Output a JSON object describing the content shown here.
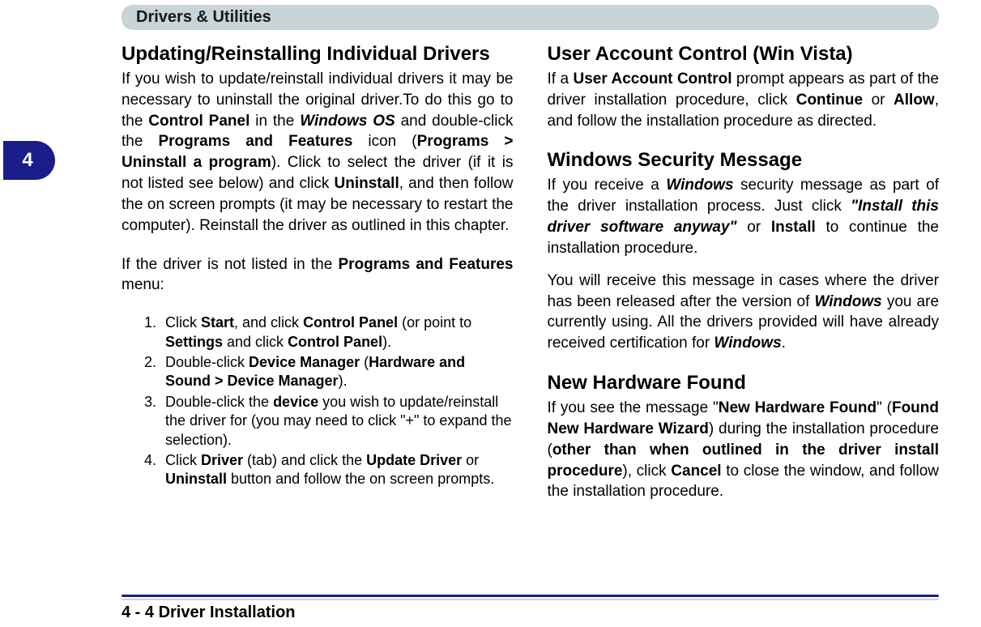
{
  "header": {
    "title": "Drivers & Utilities"
  },
  "chapter": {
    "tab": "4"
  },
  "left": {
    "h1": "Updating/Reinstalling Individual Drivers",
    "p1_a": "If you wish to update/reinstall individual drivers it may be necessary to uninstall the original driver.To do this go to the ",
    "p1_b": "Control Panel",
    "p1_c": " in the ",
    "p1_d": "Windows OS",
    "p1_e": " and double-click the ",
    "p1_f": "Programs and Features",
    "p1_g": " icon (",
    "p1_h": "Programs > Uninstall a program",
    "p1_i": "). Click to select the driver (if it is not listed see below) and click ",
    "p1_j": "Uninstall",
    "p1_k": ", and then follow the on screen prompts (it may be necessary to restart the computer). Reinstall the driver as outlined in this chapter.",
    "p2_a": "If the driver is not listed in the ",
    "p2_b": "Programs and Features",
    "p2_c": " menu:",
    "li1_a": "Click ",
    "li1_b": "Start",
    "li1_c": ", and click ",
    "li1_d": "Control Panel",
    "li1_e": " (or point to ",
    "li1_f": "Settings",
    "li1_g": " and click ",
    "li1_h": "Control Panel",
    "li1_i": ").",
    "li2_a": "Double-click ",
    "li2_b": "Device Manager",
    "li2_c": " (",
    "li2_d": "Hardware and Sound > Device Manager",
    "li2_e": ").",
    "li3_a": "Double-click the ",
    "li3_b": "device",
    "li3_c": " you wish to update/reinstall the driver for (you may need to click \"+\" to expand the selection).",
    "li4_a": "Click ",
    "li4_b": "Driver",
    "li4_c": " (tab) and click the ",
    "li4_d": "Update Driver",
    "li4_e": " or ",
    "li4_f": "Uninstall",
    "li4_g": " button and follow the on screen prompts."
  },
  "right": {
    "h1": "User Account Control (Win Vista)",
    "p1_a": "If a ",
    "p1_b": "User Account Control",
    "p1_c": " prompt appears as part of the driver installation procedure, click ",
    "p1_d": "Continue",
    "p1_e": " or ",
    "p1_f": "Allow",
    "p1_g": ", and follow the installation procedure as directed.",
    "h2": "Windows Security Message",
    "p2_a": "If you receive a ",
    "p2_b": "Windows",
    "p2_c": " security message as part of the driver installation process. Just click ",
    "p2_d": "\"Install this driver software anyway\"",
    "p2_e": " or ",
    "p2_f": "Install",
    "p2_g": " to continue the installation procedure.",
    "p3_a": "You will receive this message in cases where the driver has been released after the version of ",
    "p3_b": "Windows",
    "p3_c": " you are currently using. All the drivers provided will have already received certification for ",
    "p3_d": "Windows",
    "p3_e": ".",
    "h3": "New Hardware Found",
    "p4_a": "If you see the message \"",
    "p4_b": "New Hardware Found",
    "p4_c": "\" (",
    "p4_d": "Found New Hardware Wizard",
    "p4_e": ") during the installation procedure (",
    "p4_f": "other than when outlined in the driver install procedure",
    "p4_g": "), click ",
    "p4_h": "Cancel",
    "p4_i": " to close the window, and follow the installation procedure."
  },
  "footer": {
    "text": "4 - 4 Driver Installation"
  }
}
